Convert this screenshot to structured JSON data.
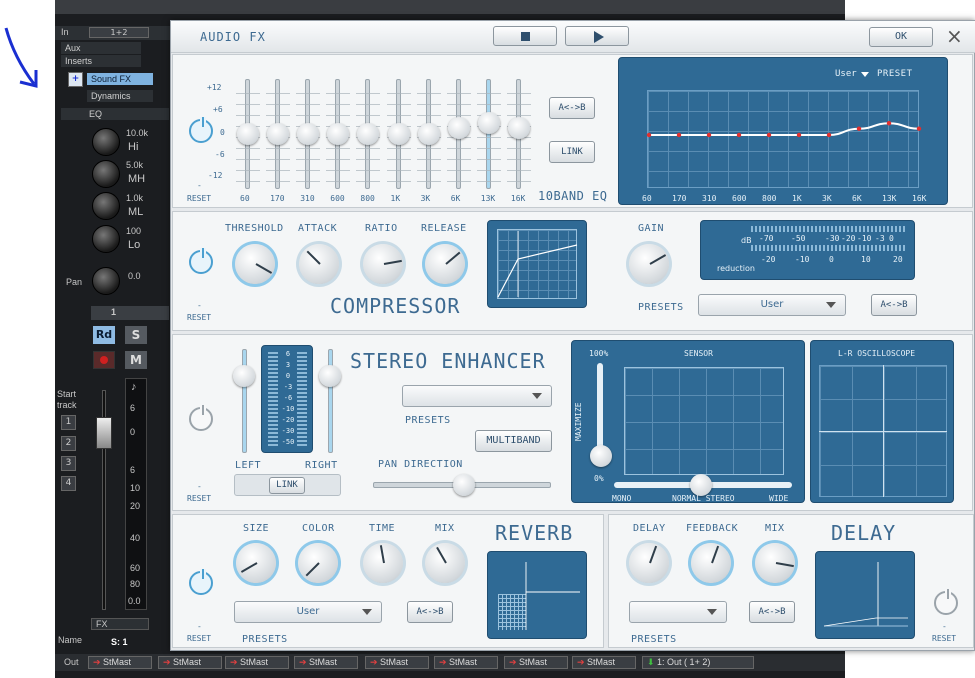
{
  "mixer": {
    "routing_value": "1+2",
    "labels": [
      "In",
      "Aux",
      "Inserts",
      "Sound FX",
      "Dynamics",
      "EQ"
    ],
    "eq_bands": [
      {
        "freq": "10.0k",
        "name": "Hi"
      },
      {
        "freq": "5.0k",
        "name": "MH"
      },
      {
        "freq": "1.0k",
        "name": "ML"
      },
      {
        "freq": "100",
        "name": "Lo"
      }
    ],
    "pan_label": "Pan",
    "pan_value": "0.0",
    "channel_number": "1",
    "rec_label": "Rd",
    "solo_label": "S",
    "mute_label": "M",
    "start_track_label": "Start track",
    "tracks": [
      "1",
      "2",
      "3",
      "4"
    ],
    "meter_scale": [
      "6",
      "0",
      "6",
      "10",
      "20",
      "40",
      "60",
      "80"
    ],
    "fader_value": "0.0",
    "fx_label": "FX",
    "name_label": "Name",
    "name_value": "S: 1",
    "out_label": "Out",
    "outputs": [
      "StMast",
      "StMast",
      "StMast",
      "StMast",
      "StMast",
      "StMast",
      "StMast",
      "StMast"
    ],
    "last_output": "1: Out ( 1+ 2)"
  },
  "window": {
    "title": "AUDIO FX",
    "ok": "OK",
    "close": "×"
  },
  "eq": {
    "name": "10BAND EQ",
    "scale": [
      "+12",
      "+6",
      "0",
      "-6",
      "-12"
    ],
    "bands": [
      "60",
      "170",
      "310",
      "600",
      "800",
      "1K",
      "3K",
      "6K",
      "13K",
      "16K"
    ],
    "gains_db": [
      0,
      0,
      0,
      0,
      0,
      0,
      0,
      1.5,
      2.8,
      1.5
    ],
    "reset": "RESET",
    "ab": "A<->B",
    "link": "LINK",
    "preset_value": "User",
    "preset_label": "PRESET"
  },
  "compressor": {
    "name": "COMPRESSOR",
    "knobs": [
      "THRESHOLD",
      "ATTACK",
      "RATIO",
      "RELEASE"
    ],
    "gain_label": "GAIN",
    "db_label": "dB",
    "db_scale": [
      "-70",
      "-50",
      "-30",
      "-20",
      "-10",
      "-3",
      "0"
    ],
    "reduction_label": "reduction",
    "reduction_scale": [
      "-20",
      "-10",
      "0",
      "10",
      "20"
    ],
    "presets_label": "PRESETS",
    "preset_value": "User",
    "ab": "A<->B",
    "reset": "RESET"
  },
  "stereo": {
    "name": "STEREO ENHANCER",
    "meter_scale": [
      "6",
      "3",
      "0",
      "-3",
      "-6",
      "-10",
      "-20",
      "-30",
      "-50"
    ],
    "left": "LEFT",
    "right": "RIGHT",
    "link": "LINK",
    "presets_label": "PRESETS",
    "multiband": "MULTIBAND",
    "pan_direction": "PAN DIRECTION",
    "reset": "RESET",
    "sensor": "SENSOR",
    "maximize": "MAXIMIZE",
    "pct_top": "100%",
    "pct_bottom": "0%",
    "mono": "MONO",
    "normal": "NORMAL STEREO",
    "wide": "WIDE",
    "oscilloscope": "L-R OSCILLOSCOPE"
  },
  "reverb": {
    "name": "REVERB",
    "knobs": [
      "SIZE",
      "COLOR",
      "TIME",
      "MIX"
    ],
    "preset_value": "User",
    "ab": "A<->B",
    "presets_label": "PRESETS",
    "reset": "RESET"
  },
  "delay": {
    "name": "DELAY",
    "knobs": [
      "DELAY",
      "FEEDBACK",
      "MIX"
    ],
    "ab": "A<->B",
    "presets_label": "PRESETS",
    "reset": "RESET"
  },
  "colors": {
    "accent": "#3d6a91",
    "screen": "#2f6a95",
    "annotation": "#1a2fd1"
  }
}
